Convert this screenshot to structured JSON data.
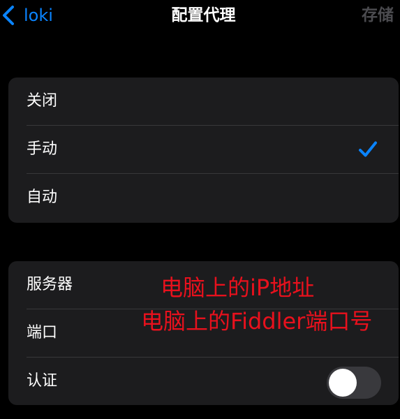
{
  "navbar": {
    "back_label": "loki",
    "title": "配置代理",
    "save_label": "存储"
  },
  "proxy_mode": {
    "options": [
      {
        "label": "关闭",
        "selected": false
      },
      {
        "label": "手动",
        "selected": true
      },
      {
        "label": "自动",
        "selected": false
      }
    ]
  },
  "server_settings": {
    "server_label": "服务器",
    "port_label": "端口",
    "auth_label": "认证",
    "auth_enabled": false
  },
  "annotations": {
    "server_hint": "电脑上的iP地址",
    "port_hint": "电脑上的Fiddler端口号"
  },
  "colors": {
    "accent": "#0a84ff",
    "background": "#000000",
    "card": "#1c1c1e",
    "annotation": "#e8111d",
    "disabled_text": "#4b4b4f"
  }
}
